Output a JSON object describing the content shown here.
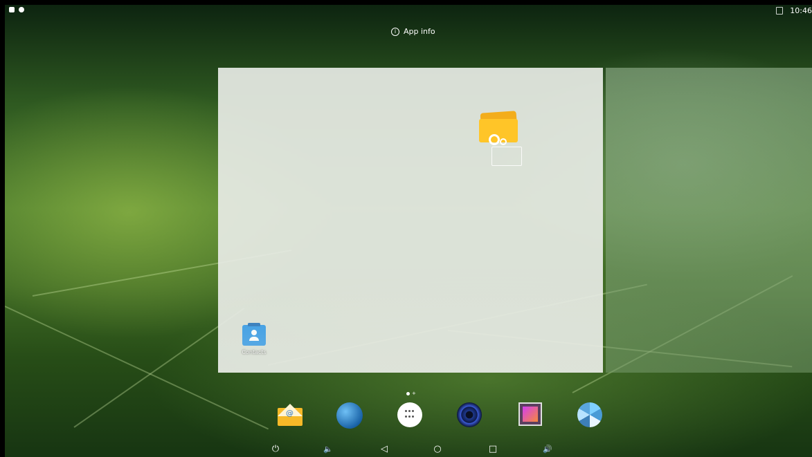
{
  "status_bar": {
    "left_icons": [
      "notification-icon",
      "android-debug-icon"
    ],
    "signal_icon": "no-sim-icon",
    "time": "10:46"
  },
  "drop_target": {
    "label": "App info",
    "icon": "info-icon"
  },
  "workspace": {
    "dragging_item": "settings-folder-icon",
    "shortcuts": [
      {
        "label": "Contacts",
        "icon": "contacts-icon"
      }
    ],
    "page_indicator": {
      "current": 1,
      "add_page_glyph": "+"
    }
  },
  "dock": {
    "items": [
      {
        "name": "Email",
        "icon": "email-icon"
      },
      {
        "name": "Browser",
        "icon": "globe-icon"
      },
      {
        "name": "Apps",
        "icon": "apps-grid-icon"
      },
      {
        "name": "Music",
        "icon": "speaker-icon"
      },
      {
        "name": "Gallery",
        "icon": "gallery-icon"
      },
      {
        "name": "Camera",
        "icon": "aperture-icon"
      }
    ]
  },
  "nav_bar": {
    "power": "⏻",
    "volume_down": "🔈",
    "back": "◁",
    "home": "○",
    "recents": "□",
    "volume_up": "🔊"
  }
}
